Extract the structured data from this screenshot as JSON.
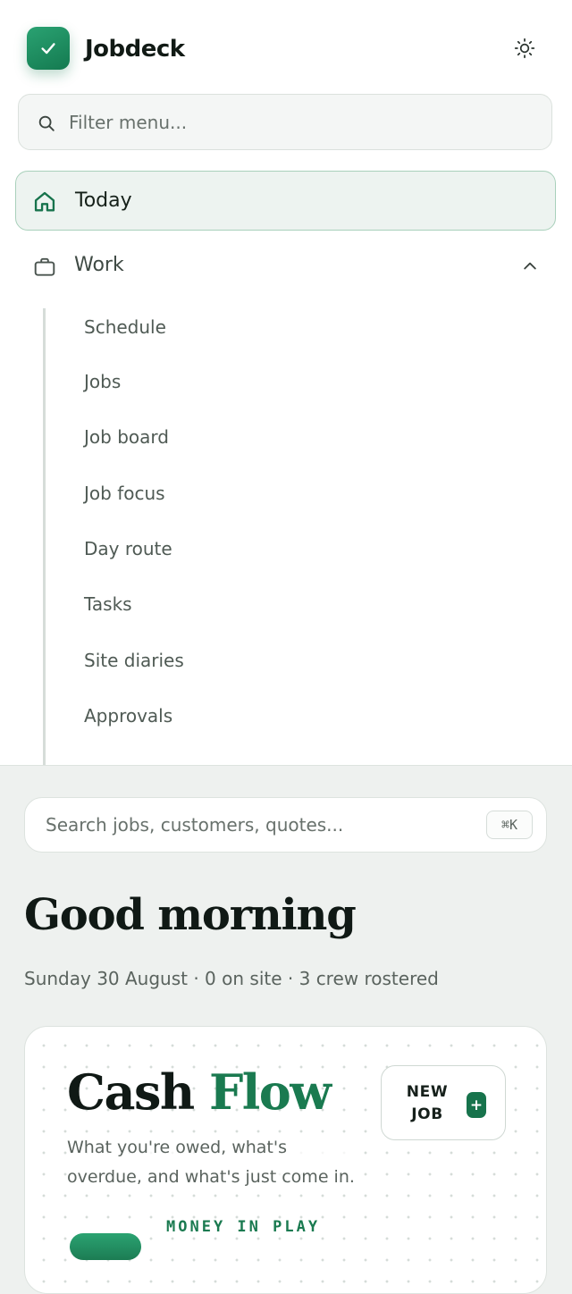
{
  "app": {
    "brand": "Jobdeck",
    "logo_icon": "check-icon",
    "theme_icon": "sun-icon",
    "accent_color": "#1a7a50"
  },
  "sidebar": {
    "filter_placeholder": "Filter menu...",
    "items": [
      {
        "label": "Today",
        "icon": "home-icon",
        "active": true
      },
      {
        "label": "Work",
        "icon": "briefcase-icon",
        "expanded": true
      }
    ],
    "work_children": [
      "Schedule",
      "Jobs",
      "Job board",
      "Job focus",
      "Day route",
      "Tasks",
      "Site diaries",
      "Approvals"
    ]
  },
  "main": {
    "search_placeholder": "Search jobs, customers, quotes...",
    "shortcut": "⌘K",
    "greeting": "Good morning",
    "subline": "Sunday 30 August · 0 on site · 3 crew rostered",
    "card": {
      "title_part1": "Cash",
      "title_part2": "Flow",
      "description": "What you're owed, what's overdue, and what's just come in.",
      "new_job_label": "NEW JOB",
      "new_job_icon": "plus-icon",
      "section_label": "MONEY IN PLAY"
    }
  }
}
